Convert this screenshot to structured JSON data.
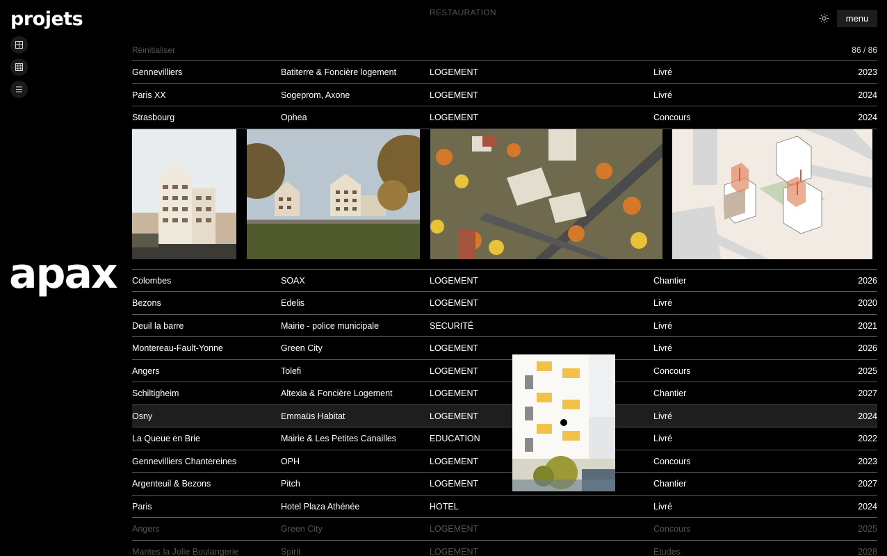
{
  "header": {
    "title": "projets",
    "filter_label": "RESTAURATION",
    "menu_label": "menu",
    "theme_icon": "sun-icon"
  },
  "sidebar": {
    "view_buttons": [
      {
        "icon": "grid-large-icon"
      },
      {
        "icon": "grid-small-icon"
      },
      {
        "icon": "list-icon"
      }
    ],
    "logo": "apax"
  },
  "toolbar": {
    "reset_label": "Réinitialiser",
    "count": "86 / 86"
  },
  "rows_top": [
    {
      "city": "Gennevilliers",
      "client": "Batiterre & Foncière logement",
      "program": "LOGEMENT",
      "status": "Livré",
      "year": "2023"
    },
    {
      "city": "Paris XX",
      "client": "Sogeprom, Axone",
      "program": "LOGEMENT",
      "status": "Livré",
      "year": "2024"
    },
    {
      "city": "Strasbourg",
      "client": "Ophea",
      "program": "LOGEMENT",
      "status": "Concours",
      "year": "2024"
    }
  ],
  "rows_bottom": [
    {
      "city": "Colombes",
      "client": "SOAX",
      "program": "LOGEMENT",
      "status": "Chantier",
      "year": "2026"
    },
    {
      "city": "Bezons",
      "client": "Edelis",
      "program": "LOGEMENT",
      "status": "Livré",
      "year": "2020"
    },
    {
      "city": "Deuil la barre",
      "client": "Mairie - police municipale",
      "program": "SECURITÉ",
      "status": "Livré",
      "year": "2021"
    },
    {
      "city": "Montereau-Fault-Yonne",
      "client": "Green City",
      "program": "LOGEMENT",
      "status": "Livré",
      "year": "2026"
    },
    {
      "city": "Angers",
      "client": "Tolefi",
      "program": "LOGEMENT",
      "status": "Concours",
      "year": "2025"
    },
    {
      "city": "Schiltigheim",
      "client": "Altexia & Foncière Logement",
      "program": "LOGEMENT",
      "status": "Chantier",
      "year": "2027"
    },
    {
      "city": "Osny",
      "client": "Emmaüs Habitat",
      "program": "LOGEMENT",
      "status": "Livré",
      "year": "2024"
    },
    {
      "city": "La Queue en Brie",
      "client": "Mairie & Les Petites Canailles",
      "program": "EDUCATION",
      "status": "Livré",
      "year": "2022"
    },
    {
      "city": "Gennevilliers Chantereines",
      "client": "OPH",
      "program": "LOGEMENT",
      "status": "Concours",
      "year": "2023"
    },
    {
      "city": "Argenteuil & Bezons",
      "client": "Pitch",
      "program": "LOGEMENT",
      "status": "Chantier",
      "year": "2027"
    },
    {
      "city": "Paris",
      "client": "Hotel Plaza Athénée",
      "program": "HOTEL",
      "status": "Livré",
      "year": "2024"
    },
    {
      "city": "Angers",
      "client": "Green City",
      "program": "LOGEMENT",
      "status": "Concours",
      "year": "2025"
    },
    {
      "city": "Mantes la Jolie Boulangerie",
      "client": "Spirit",
      "program": "LOGEMENT",
      "status": "Etudes",
      "year": "2028"
    }
  ]
}
